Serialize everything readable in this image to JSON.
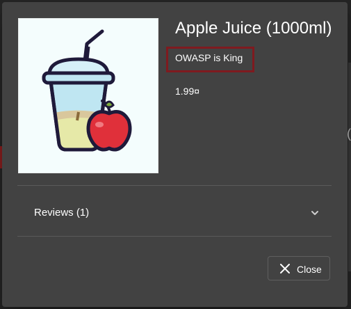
{
  "product": {
    "title": "Apple Juice (1000ml)",
    "description": "OWASP is King",
    "price": "1.99¤",
    "image_icon": "apple-juice-cup-image"
  },
  "reviews": {
    "label": "Reviews (1)",
    "expand_icon": "chevron-down-icon"
  },
  "actions": {
    "close_label": "Close",
    "close_icon": "close-icon"
  },
  "colors": {
    "dialog_bg": "#424242",
    "highlight_border": "#7f1a1f",
    "text": "#ffffff"
  }
}
